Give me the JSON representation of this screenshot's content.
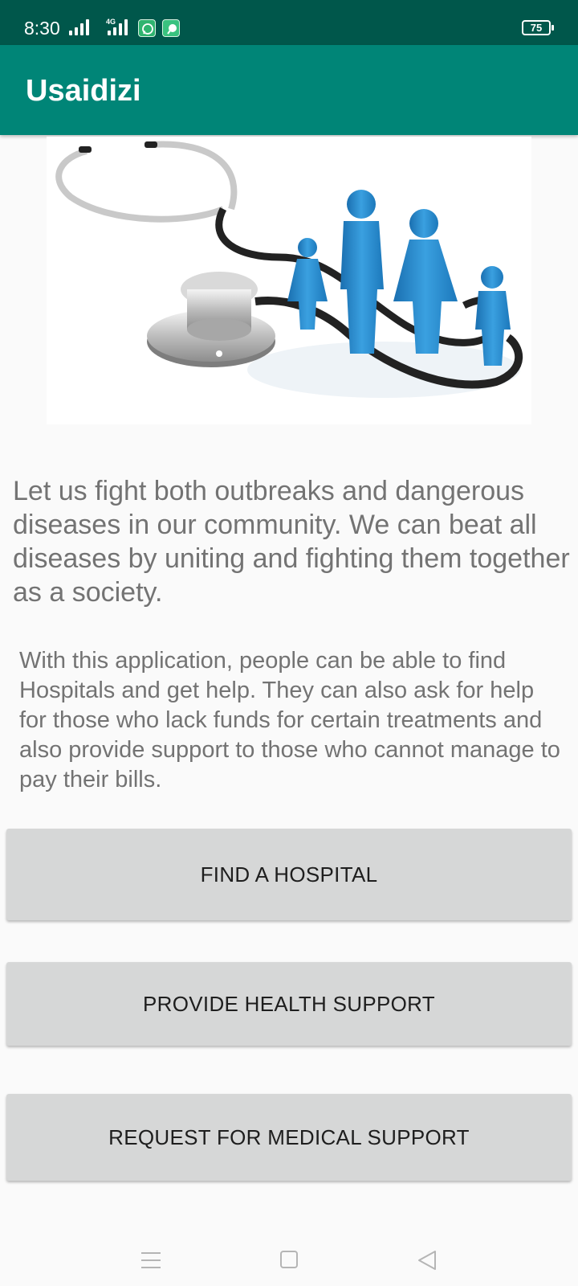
{
  "status_bar": {
    "time": "8:30",
    "network_tag": "4G",
    "battery": "75"
  },
  "app_bar": {
    "title": "Usaidizi"
  },
  "hero_image": {
    "description": "stethoscope-family-illustration"
  },
  "content": {
    "intro": "Let us fight both outbreaks and dangerous diseases in our community. We can beat all diseases by uniting and fighting them together as a society.",
    "description": "With this application, people can be able to find Hospitals and get help. They can also ask for help for those who lack funds for certain treatments and also provide support to those who cannot manage to pay their bills."
  },
  "buttons": {
    "find_hospital": "FIND A HOSPITAL",
    "provide_support": "PROVIDE HEALTH SUPPORT",
    "request_support": "REQUEST FOR MEDICAL SUPPORT"
  },
  "colors": {
    "status_bar": "#00574b",
    "app_bar": "#008577",
    "button_bg": "#d6d7d7",
    "body_text": "#737373",
    "figure_blue": "#2d8fd1"
  },
  "icons": {
    "nav_menu": "menu-lines-icon",
    "nav_home": "square-home-icon",
    "nav_back": "triangle-back-icon"
  }
}
